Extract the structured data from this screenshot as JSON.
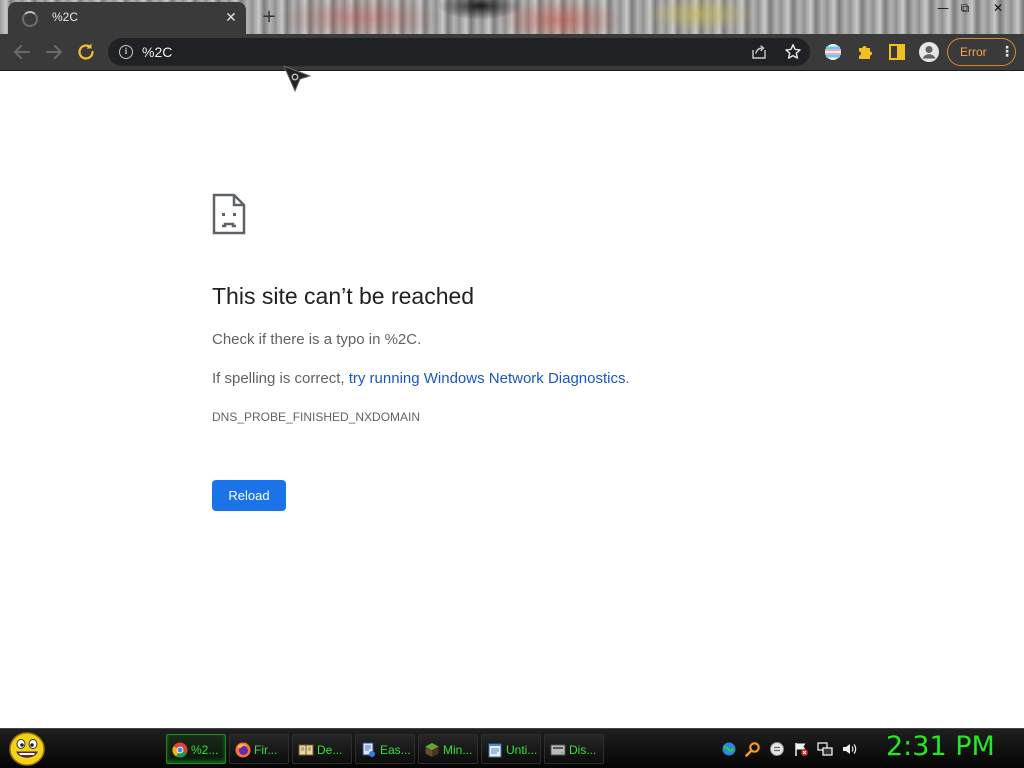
{
  "window": {
    "tab_title": "%2C",
    "tab_close": "✕",
    "new_tab": "+",
    "minimize": "—",
    "restore": "⧉",
    "close": "✕"
  },
  "toolbar": {
    "url": "%2C",
    "error_label": "Error",
    "menu_dots": "⋮"
  },
  "page": {
    "heading": "This site can’t be reached",
    "typo_text": "Check if there is a typo in %2C.",
    "spelling_prefix": "If spelling is correct, ",
    "diagnostics_link": "try running Windows Network Diagnostics",
    "spelling_suffix": ".",
    "error_code": "DNS_PROBE_FINISHED_NXDOMAIN",
    "reload_label": "Reload"
  },
  "taskbar": {
    "tasks": [
      {
        "label": "%2...",
        "icon": "chrome-icon",
        "active": true
      },
      {
        "label": "Fir...",
        "icon": "firefox-icon",
        "active": false
      },
      {
        "label": "De...",
        "icon": "book-icon",
        "active": false
      },
      {
        "label": "Eas...",
        "icon": "easy-icon",
        "active": false
      },
      {
        "label": "Min...",
        "icon": "minecraft-icon",
        "active": false
      },
      {
        "label": "Unti...",
        "icon": "notepad-icon",
        "active": false
      },
      {
        "label": "Dis...",
        "icon": "disk-icon",
        "active": false
      }
    ],
    "clock": "2:31 PM"
  },
  "colors": {
    "accent_blue": "#1a73e8",
    "link_blue": "#1a56c8",
    "error_orange": "#f6a54a",
    "taskbar_green": "#38e038",
    "clock_green": "#23e823"
  }
}
